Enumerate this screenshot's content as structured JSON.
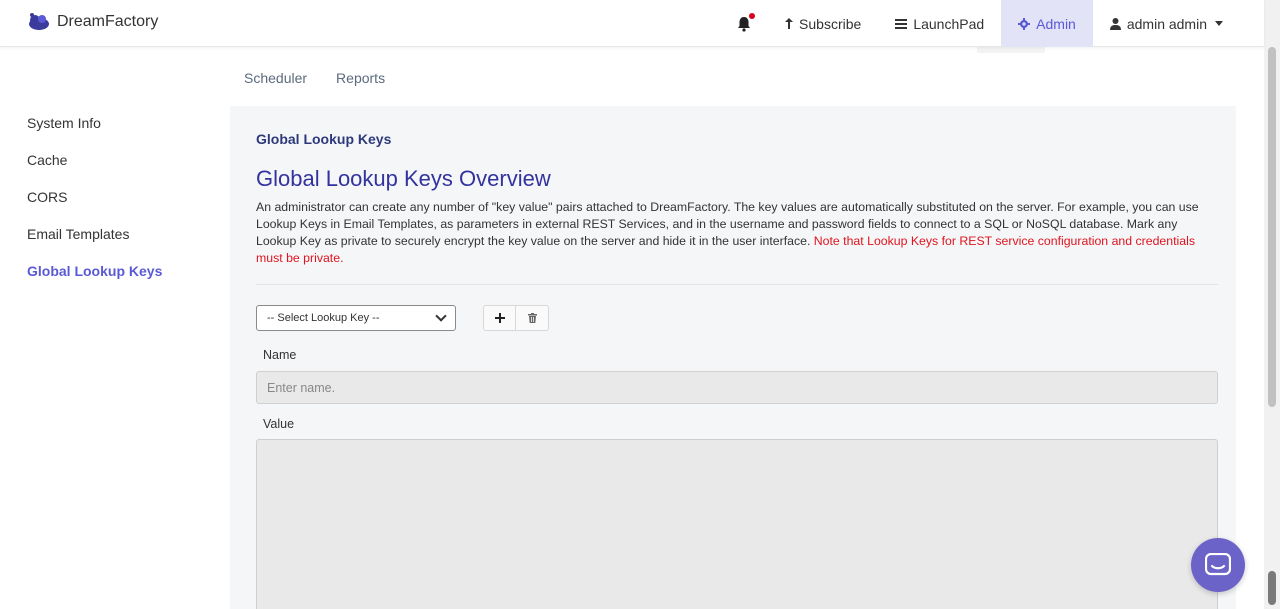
{
  "brand": {
    "name": "DreamFactory"
  },
  "nav": {
    "notifications_icon": "bell-icon",
    "subscribe": "Subscribe",
    "launchpad": "LaunchPad",
    "admin": "Admin",
    "user": "admin admin"
  },
  "subtabs": [
    "Scheduler",
    "Reports"
  ],
  "sidebar": {
    "items": [
      {
        "label": "System Info"
      },
      {
        "label": "Cache"
      },
      {
        "label": "CORS"
      },
      {
        "label": "Email Templates"
      },
      {
        "label": "Global Lookup Keys",
        "active": true
      }
    ]
  },
  "main": {
    "breadcrumb": "Global Lookup Keys",
    "title": "Global Lookup Keys Overview",
    "description": "An administrator can create any number of \"key value\" pairs attached to DreamFactory. The key values are automatically substituted on the server. For example, you can use Lookup Keys in Email Templates, as parameters in external REST Services, and in the username and password fields to connect to a SQL or NoSQL database. Mark any Lookup Key as private to securely encrypt the key value on the server and hide it in the user interface.",
    "description_warning": "Note that Lookup Keys for REST service configuration and credentials must be private.",
    "select_value": "-- Select Lookup Key --",
    "name_label": "Name",
    "name_placeholder": "Enter name.",
    "value_label": "Value"
  },
  "colors": {
    "accent": "#5a5ad6",
    "title": "#3333a0",
    "warning": "#e0141e",
    "chat": "#6c63c8"
  }
}
